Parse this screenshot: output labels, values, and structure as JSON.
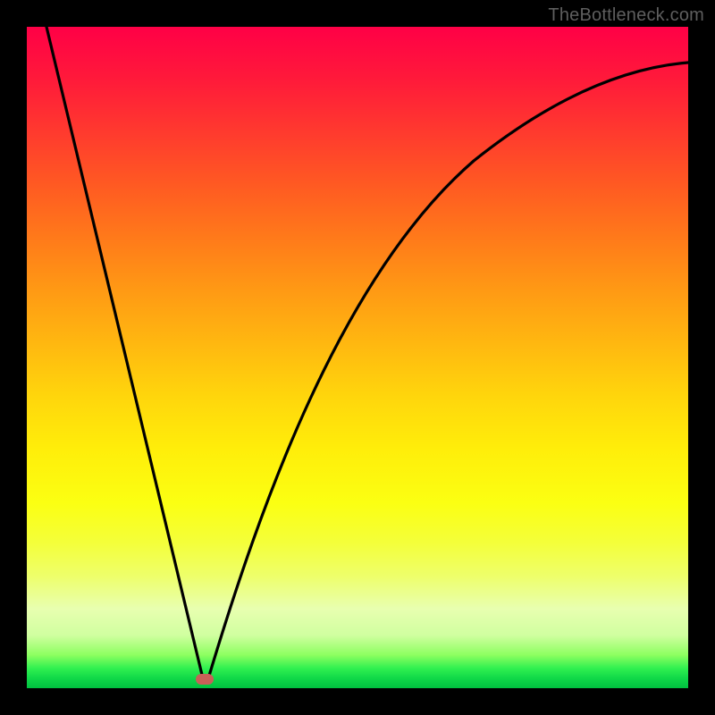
{
  "watermark": "TheBottleneck.com",
  "chart_data": {
    "type": "line",
    "title": "",
    "xlabel": "",
    "ylabel": "",
    "xlim": [
      0,
      100
    ],
    "ylim": [
      0,
      100
    ],
    "grid": false,
    "legend": false,
    "series": [
      {
        "name": "bottleneck-curve",
        "x": [
          3,
          5,
          8,
          11,
          14,
          17,
          20,
          23,
          25,
          26.5,
          28,
          30,
          33,
          36,
          40,
          45,
          50,
          56,
          63,
          72,
          82,
          92,
          100
        ],
        "y": [
          100,
          90,
          78,
          66,
          54,
          42,
          30,
          18,
          8,
          2,
          4,
          12,
          24,
          36,
          50,
          62,
          70,
          76,
          81,
          85,
          88,
          90.5,
          92
        ]
      }
    ],
    "marker": {
      "x": 26.5,
      "y": 1
    },
    "gradient_stops": [
      {
        "pos": 0,
        "color": "#ff0046"
      },
      {
        "pos": 50,
        "color": "#ffd000"
      },
      {
        "pos": 80,
        "color": "#f8ff40"
      },
      {
        "pos": 100,
        "color": "#00c040"
      }
    ]
  }
}
